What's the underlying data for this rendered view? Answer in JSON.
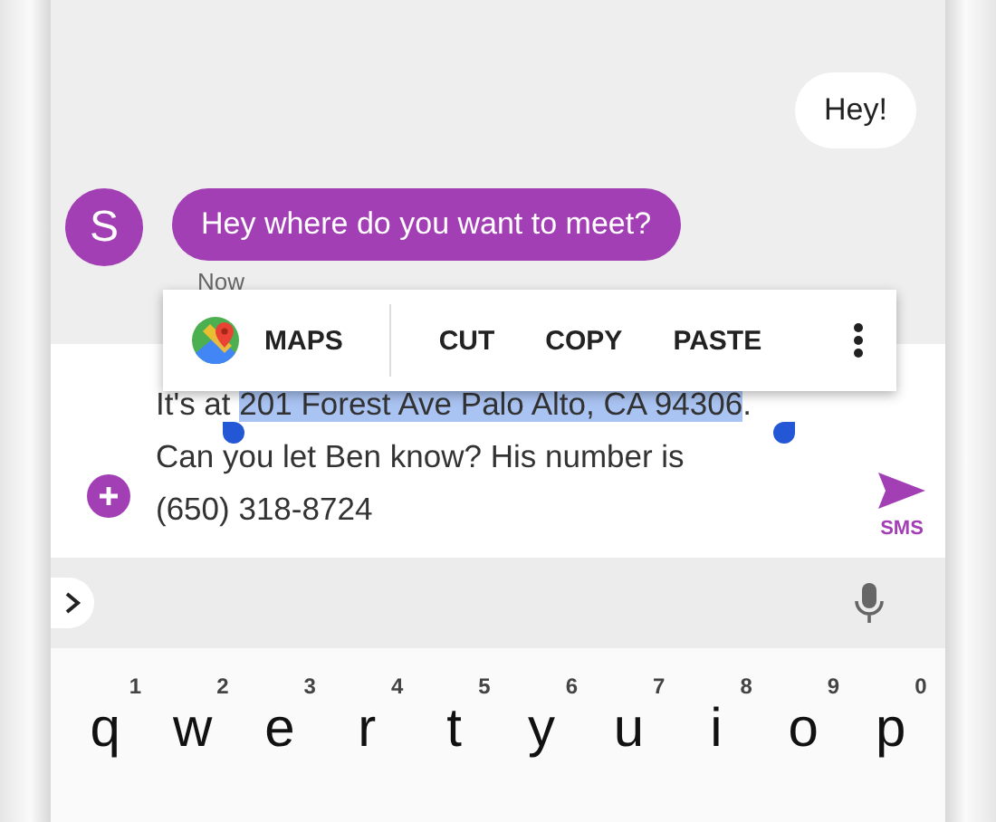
{
  "conversation": {
    "messages": [
      {
        "kind": "sent",
        "text": "Hey!"
      },
      {
        "kind": "received",
        "avatar_letter": "S",
        "text": "Hey where do you want to meet?",
        "time": "Now"
      }
    ]
  },
  "selection_menu": {
    "items": [
      {
        "kind": "app",
        "label": "MAPS"
      },
      {
        "kind": "action",
        "label": "CUT"
      },
      {
        "kind": "action",
        "label": "COPY"
      },
      {
        "kind": "action",
        "label": "PASTE"
      },
      {
        "kind": "more"
      }
    ]
  },
  "compose": {
    "text_before": "It's at ",
    "selected_text": "201 Forest Ave Palo Alto, CA 94306",
    "text_after": ".\nCan you let Ben know? His number is\n(650) 318-8724",
    "send_label": "SMS"
  },
  "keyboard": {
    "keys": [
      {
        "letter": "q",
        "hint": "1"
      },
      {
        "letter": "w",
        "hint": "2"
      },
      {
        "letter": "e",
        "hint": "3"
      },
      {
        "letter": "r",
        "hint": "4"
      },
      {
        "letter": "t",
        "hint": "5"
      },
      {
        "letter": "y",
        "hint": "6"
      },
      {
        "letter": "u",
        "hint": "7"
      },
      {
        "letter": "i",
        "hint": "8"
      },
      {
        "letter": "o",
        "hint": "9"
      },
      {
        "letter": "p",
        "hint": "0"
      }
    ]
  }
}
